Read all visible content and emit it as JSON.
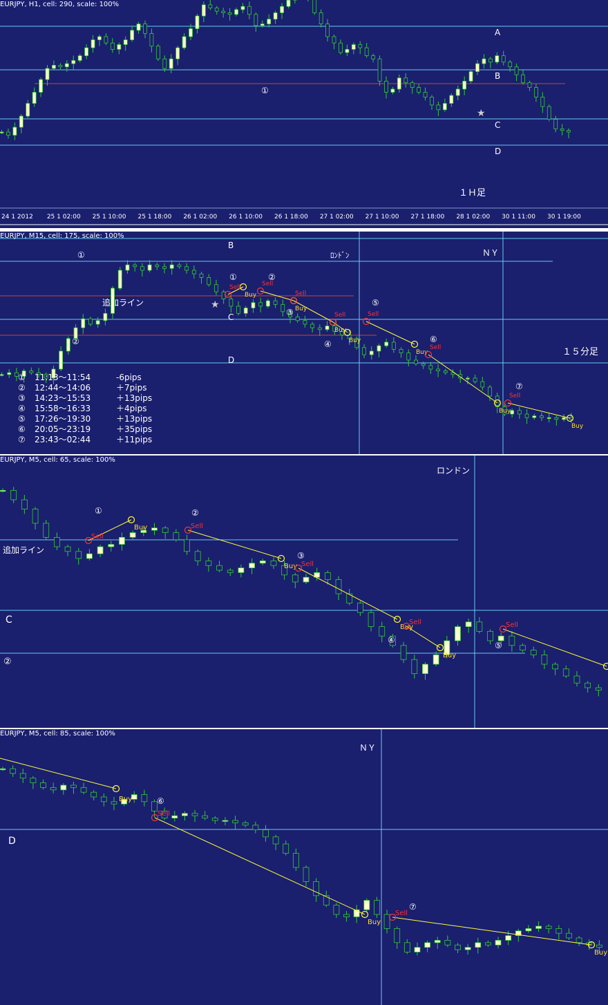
{
  "colors": {
    "background": "#1a1f6e",
    "bull_candle": "#ffffcc",
    "candle_line": "#33cc33",
    "level_line": "#66ccee",
    "red_line": "#cc4433",
    "trend_line": "#ffff33",
    "buy_label": "#ffdd33",
    "sell_label": "#ff3333",
    "text": "#ffffff",
    "grid": "#8899cc"
  },
  "chart_data": [
    {
      "type": "candlestick",
      "title": "EURJPY, H1, cell: 290, scale: 100%",
      "timeframe_label": "１Ｈ足",
      "x_tick_labels": [
        "24 1 2012",
        "25 1 02:00",
        "25 1 10:00",
        "25 1 18:00",
        "26 1 02:00",
        "26 1 10:00",
        "26 1 18:00",
        "27 1 02:00",
        "27 1 10:00",
        "27 1 18:00",
        "28 1 02:00",
        "30 1 11:00",
        "30 1 19:00"
      ],
      "level_labels": [
        "A",
        "B",
        "C",
        "D"
      ],
      "marker_labels": [
        "①"
      ],
      "star": "★",
      "closes": [
        0.3,
        0.28,
        0.33,
        0.4,
        0.48,
        0.55,
        0.63,
        0.7,
        0.72,
        0.71,
        0.73,
        0.75,
        0.78,
        0.83,
        0.88,
        0.9,
        0.86,
        0.82,
        0.85,
        0.88,
        0.94,
        0.98,
        0.92,
        0.84,
        0.76,
        0.7,
        0.76,
        0.83,
        0.9,
        0.95,
        1.03,
        1.1,
        1.08,
        1.06,
        1.05,
        1.04,
        1.07,
        1.09,
        1.04,
        0.97,
        0.98,
        1.01,
        1.05,
        1.09,
        1.13,
        1.18,
        1.21,
        1.16,
        1.05,
        0.98,
        0.9,
        0.86,
        0.8,
        0.82,
        0.85,
        0.83,
        0.78,
        0.76,
        0.62,
        0.55,
        0.57,
        0.64,
        0.61,
        0.58,
        0.55,
        0.52,
        0.47,
        0.44,
        0.48,
        0.53,
        0.57,
        0.62,
        0.68,
        0.73,
        0.76,
        0.74,
        0.78,
        0.74,
        0.71,
        0.66,
        0.61,
        0.58,
        0.52,
        0.46,
        0.38,
        0.32,
        0.31,
        0.3
      ]
    },
    {
      "type": "candlestick",
      "title": "EURJPY, M15, cell: 175, scale: 100%",
      "timeframe_label": "１５分足",
      "level_labels": [
        "B",
        "C",
        "D",
        "①",
        "②"
      ],
      "session_labels": [
        "ﾛﾝﾄﾞﾝ",
        "ＮＹ"
      ],
      "added_line_label": "追加ライン",
      "star": "★",
      "trade_markers": [
        "①",
        "②",
        "③",
        "④",
        "⑤",
        "⑥",
        "⑦"
      ],
      "buy_label": "Buy",
      "sell_label": "Sell",
      "trade_table": [
        {
          "id": "①",
          "time": "11:13～11:54",
          "pips": "-6pips"
        },
        {
          "id": "②",
          "time": "12:44～14:06",
          "pips": "＋7pips"
        },
        {
          "id": "③",
          "time": "14:23～15:53",
          "pips": "＋13pips"
        },
        {
          "id": "④",
          "time": "15:58～16:33",
          "pips": "＋4pips"
        },
        {
          "id": "⑤",
          "time": "17:26～19:30",
          "pips": "＋13pips"
        },
        {
          "id": "⑥",
          "time": "20:05～23:19",
          "pips": "＋35pips"
        },
        {
          "id": "⑦",
          "time": "23:43～02:44",
          "pips": "＋11pips"
        }
      ],
      "closes": [
        0.32,
        0.33,
        0.31,
        0.34,
        0.33,
        0.32,
        0.3,
        0.35,
        0.45,
        0.52,
        0.58,
        0.63,
        0.6,
        0.62,
        0.66,
        0.8,
        0.9,
        0.93,
        0.92,
        0.9,
        0.93,
        0.92,
        0.91,
        0.93,
        0.92,
        0.9,
        0.88,
        0.86,
        0.82,
        0.78,
        0.74,
        0.7,
        0.66,
        0.69,
        0.72,
        0.7,
        0.73,
        0.71,
        0.67,
        0.64,
        0.62,
        0.6,
        0.58,
        0.57,
        0.59,
        0.56,
        0.54,
        0.52,
        0.47,
        0.43,
        0.45,
        0.48,
        0.5,
        0.46,
        0.44,
        0.4,
        0.38,
        0.37,
        0.35,
        0.34,
        0.33,
        0.32,
        0.3,
        0.3,
        0.28,
        0.25,
        0.2,
        0.14,
        0.1,
        0.12,
        0.1,
        0.08,
        0.09,
        0.08,
        0.08,
        0.07,
        0.08,
        0.07
      ]
    },
    {
      "type": "candlestick",
      "title": "EURJPY, M5, cell: 65, scale: 100%",
      "level_labels": [
        "C",
        "②"
      ],
      "session_label": "ロンドン",
      "added_line_label": "追加ライン",
      "trade_markers": [
        "①",
        "②",
        "③",
        "④",
        "⑤"
      ],
      "buy_label": "Buy",
      "sell_label": "Sell",
      "closes": [
        0.94,
        0.9,
        0.86,
        0.8,
        0.74,
        0.7,
        0.68,
        0.65,
        0.67,
        0.7,
        0.71,
        0.74,
        0.76,
        0.77,
        0.78,
        0.76,
        0.73,
        0.68,
        0.64,
        0.62,
        0.6,
        0.59,
        0.61,
        0.63,
        0.64,
        0.62,
        0.58,
        0.55,
        0.57,
        0.59,
        0.56,
        0.5,
        0.46,
        0.42,
        0.36,
        0.32,
        0.28,
        0.22,
        0.16,
        0.2,
        0.24,
        0.3,
        0.36,
        0.38,
        0.34,
        0.3,
        0.32,
        0.28,
        0.26,
        0.24,
        0.2,
        0.18,
        0.15,
        0.12,
        0.1,
        0.09
      ]
    },
    {
      "type": "candlestick",
      "title": "EURJPY, M5, cell: 85, scale: 100%",
      "level_labels": [
        "D"
      ],
      "session_label": "ＮＹ",
      "trade_markers": [
        "⑥",
        "⑦"
      ],
      "buy_label": "Buy",
      "sell_label": "Sell",
      "closes": [
        0.92,
        0.9,
        0.88,
        0.86,
        0.84,
        0.83,
        0.85,
        0.84,
        0.82,
        0.8,
        0.78,
        0.77,
        0.79,
        0.81,
        0.78,
        0.74,
        0.71,
        0.72,
        0.73,
        0.72,
        0.71,
        0.7,
        0.7,
        0.69,
        0.68,
        0.66,
        0.63,
        0.6,
        0.56,
        0.5,
        0.44,
        0.38,
        0.34,
        0.3,
        0.29,
        0.32,
        0.36,
        0.3,
        0.24,
        0.18,
        0.14,
        0.16,
        0.18,
        0.19,
        0.17,
        0.15,
        0.16,
        0.18,
        0.17,
        0.19,
        0.21,
        0.23,
        0.24,
        0.25,
        0.24,
        0.22,
        0.2,
        0.18,
        0.17,
        0.16
      ]
    }
  ]
}
